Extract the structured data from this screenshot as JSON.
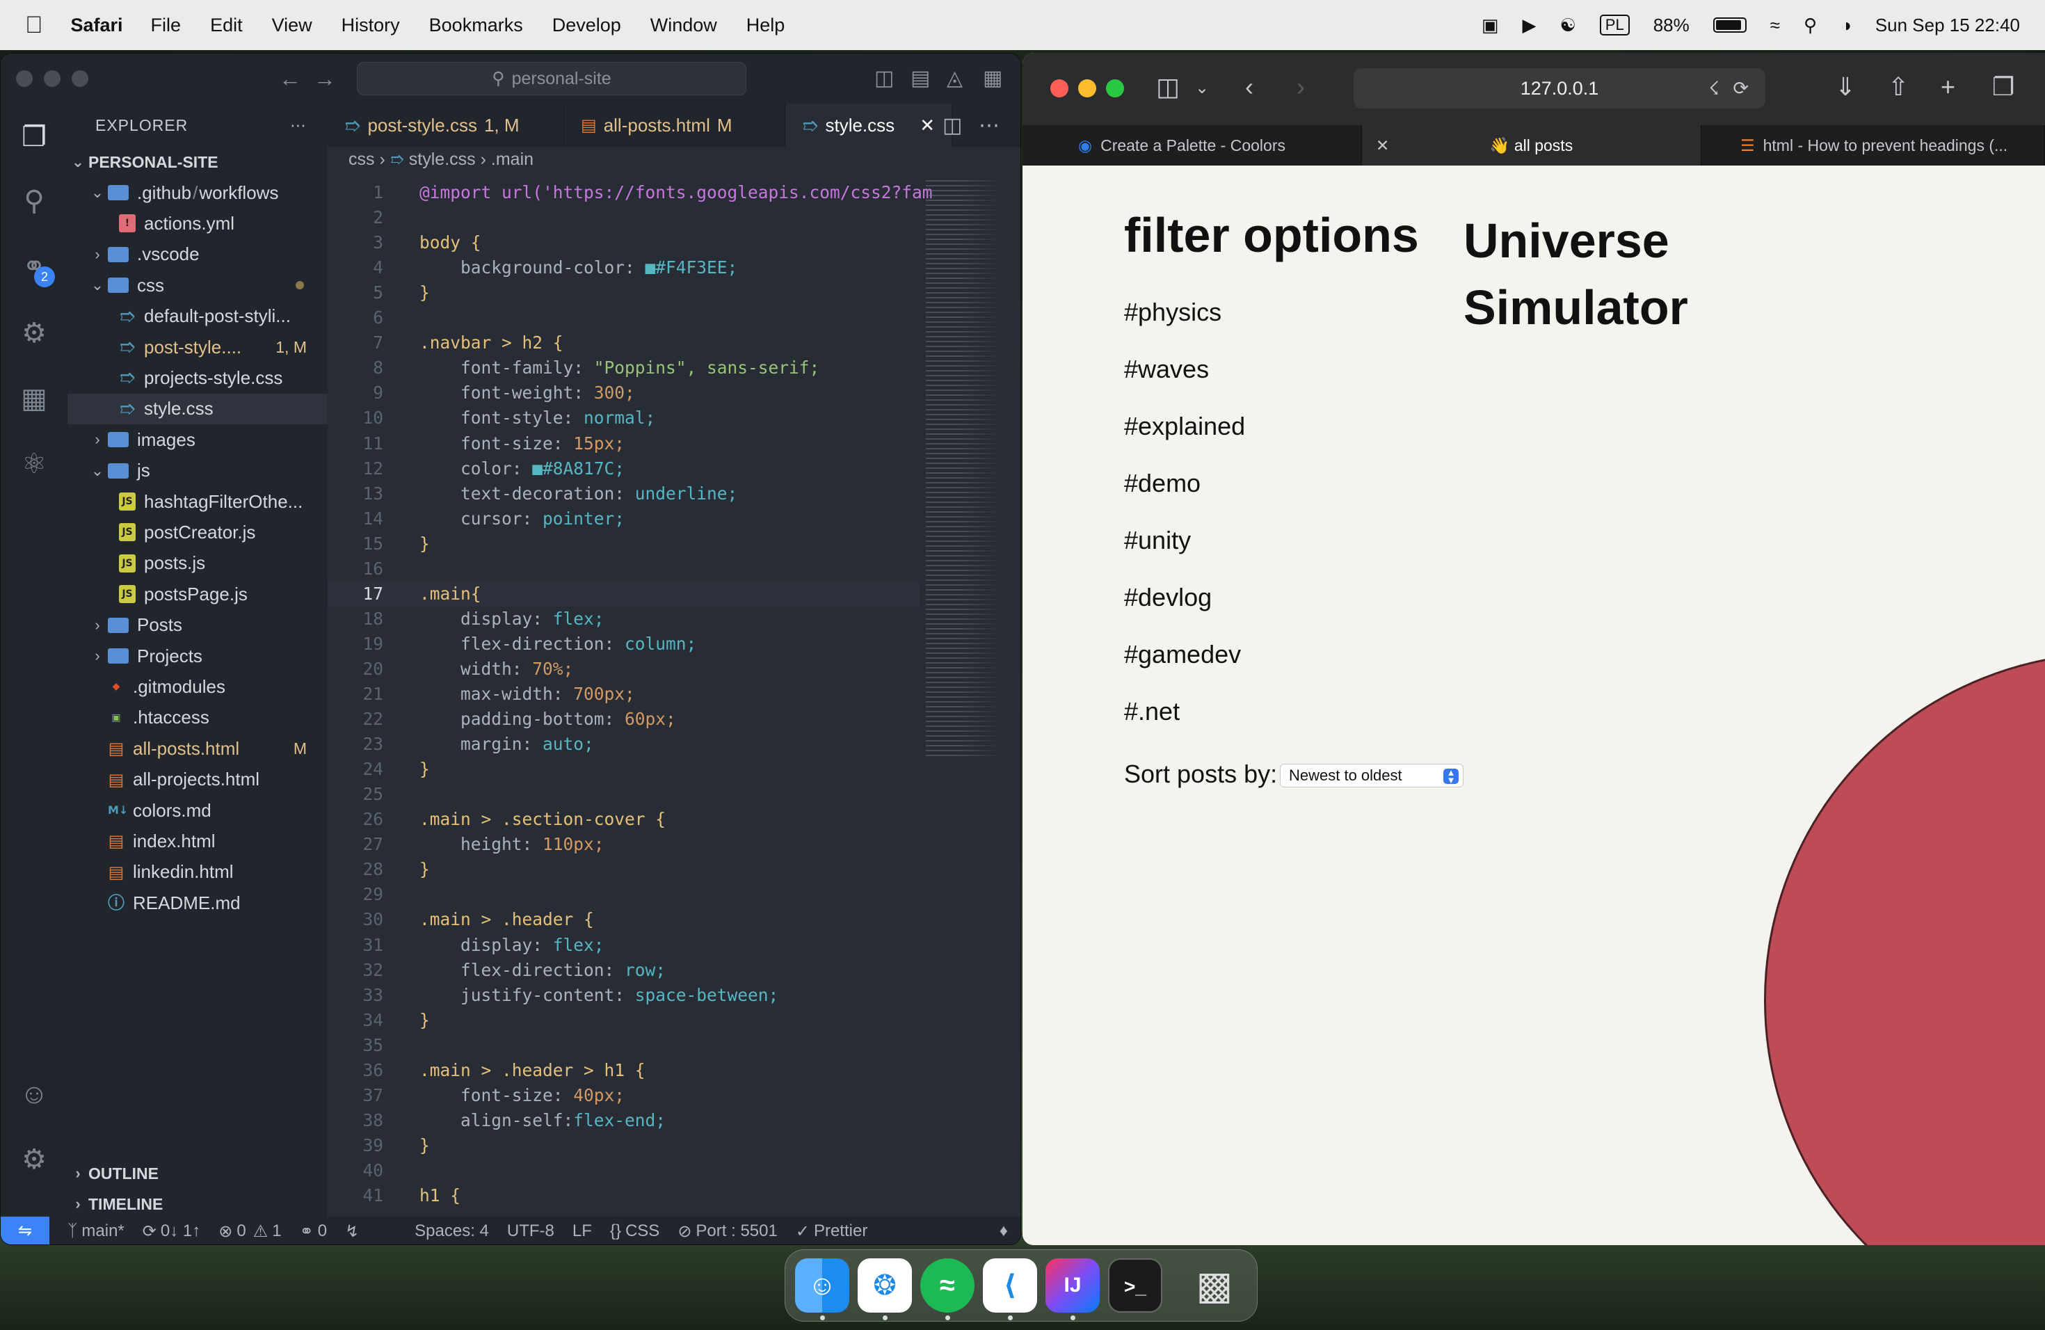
{
  "menubar": {
    "app": "Safari",
    "items": [
      "File",
      "Edit",
      "View",
      "History",
      "Bookmarks",
      "Develop",
      "Window",
      "Help"
    ],
    "input_source": "PL",
    "battery": "88%",
    "datetime": "Sun Sep 15  22:40"
  },
  "vscode": {
    "search": "personal-site",
    "explorer_title": "EXPLORER",
    "project": "PERSONAL-SITE",
    "scm_badge": "2",
    "tree": [
      {
        "label": ".github",
        "sep": "/",
        "label2": "workflows",
        "type": "folder",
        "open": true
      },
      {
        "label": "actions.yml",
        "type": "yml"
      },
      {
        "label": ".vscode",
        "type": "folder",
        "open": false
      },
      {
        "label": "css",
        "type": "folder",
        "open": true
      },
      {
        "label": "default-post-styli...",
        "type": "css"
      },
      {
        "label": "post-style....",
        "type": "css",
        "git": "1, M"
      },
      {
        "label": "projects-style.css",
        "type": "css"
      },
      {
        "label": "style.css",
        "type": "css"
      },
      {
        "label": "images",
        "type": "folder",
        "open": false
      },
      {
        "label": "js",
        "type": "folder",
        "open": true
      },
      {
        "label": "hashtagFilterOthe...",
        "type": "js"
      },
      {
        "label": "postCreator.js",
        "type": "js"
      },
      {
        "label": "posts.js",
        "type": "js"
      },
      {
        "label": "postsPage.js",
        "type": "js"
      },
      {
        "label": "Posts",
        "type": "folder",
        "open": false
      },
      {
        "label": "Projects",
        "type": "folder",
        "open": false
      },
      {
        "label": ".gitmodules",
        "type": "git"
      },
      {
        "label": ".htaccess",
        "type": "htaccess"
      },
      {
        "label": "all-posts.html",
        "type": "html",
        "git": "M"
      },
      {
        "label": "all-projects.html",
        "type": "html"
      },
      {
        "label": "colors.md",
        "type": "md"
      },
      {
        "label": "index.html",
        "type": "html"
      },
      {
        "label": "linkedin.html",
        "type": "html"
      },
      {
        "label": "README.md",
        "type": "info"
      }
    ],
    "outline": "OUTLINE",
    "timeline": "TIMELINE",
    "tabs": [
      {
        "label": "post-style.css",
        "status": "1, M"
      },
      {
        "label": "all-posts.html",
        "status": "M"
      },
      {
        "label": "style.css",
        "status": ""
      }
    ],
    "breadcrumb": {
      "a": "css",
      "b": "style.css",
      "c": ".main"
    },
    "code": [
      "@import url('https://fonts.googleapis.com/css2?fam",
      "",
      "body {",
      "    background-color: ■#F4F3EE;",
      "}",
      "",
      ".navbar > h2 {",
      "    font-family: \"Poppins\", sans-serif;",
      "    font-weight: 300;",
      "    font-style: normal;",
      "    font-size: 15px;",
      "    color: ■#8A817C;",
      "    text-decoration: underline;",
      "    cursor: pointer;",
      "}",
      "",
      ".main{",
      "    display: flex;",
      "    flex-direction: column;",
      "    width: 70%;",
      "    max-width: 700px;",
      "    padding-bottom: 60px;",
      "    margin: auto;",
      "}",
      "",
      ".main > .section-cover {",
      "    height: 110px;",
      "}",
      "",
      ".main > .header {",
      "    display: flex;",
      "    flex-direction: row;",
      "    justify-content: space-between;",
      "}",
      "",
      ".main > .header > h1 {",
      "    font-size: 40px;",
      "    align-self:flex-end;",
      "}",
      "",
      "h1 {"
    ],
    "current_line": 17,
    "status": {
      "branch": "main*",
      "sync": "0↓ 1↑",
      "errors": "0",
      "warnings": "1",
      "ports": "0",
      "spaces": "Spaces: 4",
      "encoding": "UTF-8",
      "eol": "LF",
      "language": "CSS",
      "port": "Port : 5501",
      "formatter": "Prettier"
    }
  },
  "safari": {
    "url": "127.0.0.1",
    "tabs": [
      {
        "label": "Create a Palette - Coolors"
      },
      {
        "label": "👋 all posts"
      },
      {
        "label": "html - How to prevent headings (..."
      }
    ],
    "page": {
      "filter_title": "filter options",
      "tags": [
        "#physics",
        "#waves",
        "#explained",
        "#demo",
        "#unity",
        "#devlog",
        "#gamedev",
        "#.net"
      ],
      "sort_label": "Sort posts by:",
      "sort_value": "Newest to oldest",
      "post_title": "Universe Simulator"
    },
    "accent": "#bd4c57"
  },
  "dock": [
    "Finder",
    "Safari",
    "Spotify",
    "Visual Studio Code",
    "IntelliJ IDEA",
    "Terminal",
    "Trash"
  ]
}
